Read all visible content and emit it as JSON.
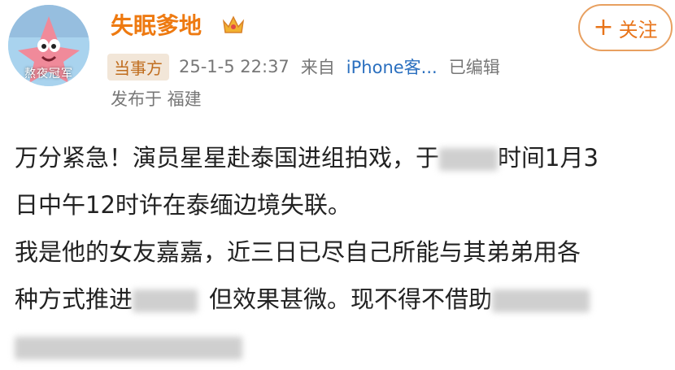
{
  "profile": {
    "name": "失眠爹地",
    "avatar_label": "熬夜冠军",
    "follow_label": "关注",
    "icons": {
      "crown": "crown-icon",
      "plus": "plus-icon"
    }
  },
  "meta": {
    "badge": "当事方",
    "datetime": "25-1-5 22:37",
    "source_prefix": "来自",
    "device": "iPhone客...",
    "edited": "已编辑",
    "location": "发布于 福建"
  },
  "post": {
    "line1_a": "万分紧急！演员星星赴泰国进组拍戏，于",
    "line1_b": "时间1月3",
    "line2": "日中午12时许在泰缅边境失联。",
    "line3": "我是他的女友嘉嘉，近三日已尽自己所能与其弟弟用各",
    "line4_a": "种方式推进",
    "line4_b": "但效果甚微。现不得不借助"
  },
  "colors": {
    "username": "#ee7a11",
    "badge_bg": "#f2e6d8",
    "badge_text": "#c06d1e",
    "link": "#2a6fbf",
    "follow_border": "#e8a060"
  }
}
